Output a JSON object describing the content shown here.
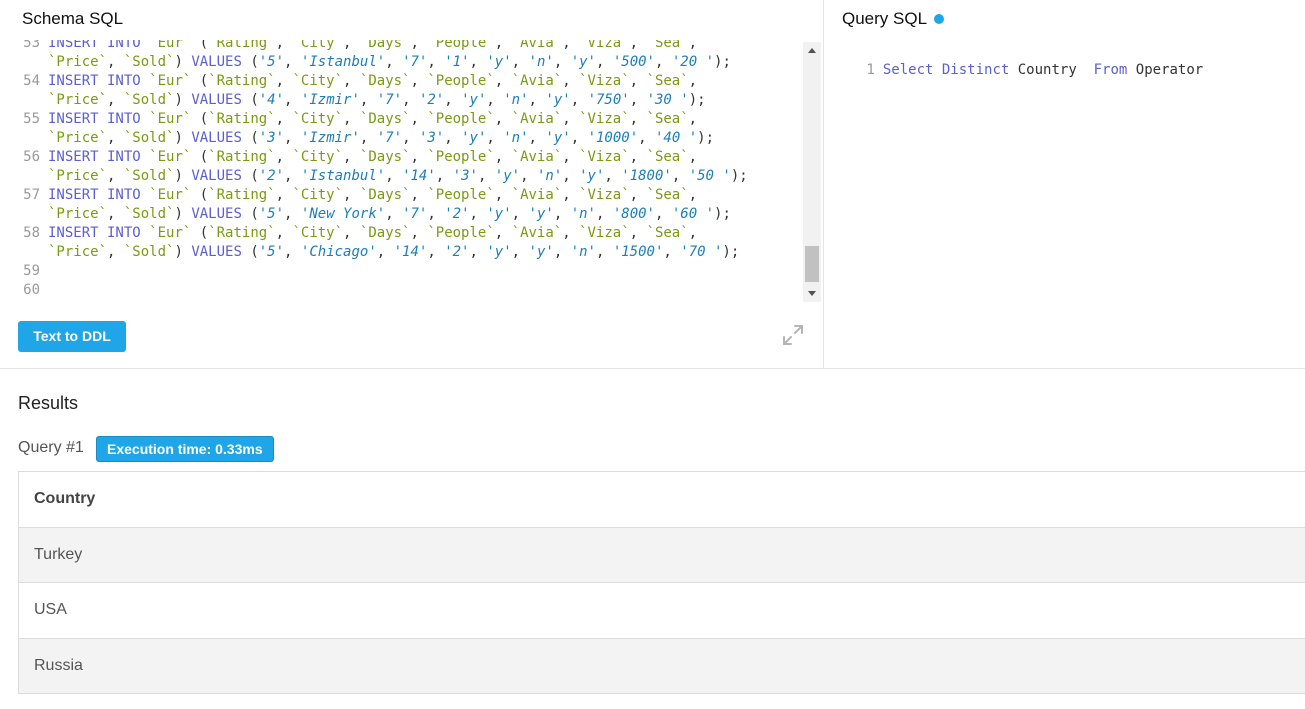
{
  "schema_panel": {
    "title": "Schema SQL",
    "lines": [
      {
        "n": "53",
        "l1": [
          "INSERT INTO `Eur` (`Rating`, `City`, `Days`, `People`, `Avia`, `Viza`, `Sea`,"
        ],
        "l2": "`Price`, `Sold`) VALUES ('5', 'Istanbul', '7', '1', 'y', 'n', 'y', '500', '20 ');"
      },
      {
        "n": "54",
        "l2": "`Price`, `Sold`) VALUES ('4', 'Izmir', '7', '2', 'y', 'n', 'y', '750', '30 ');"
      },
      {
        "n": "55",
        "l2": "`Price`, `Sold`) VALUES ('3', 'Izmir', '7', '3', 'y', 'n', 'y', '1000', '40 ');"
      },
      {
        "n": "56",
        "l2": "`Price`, `Sold`) VALUES ('2', 'Istanbul', '14', '3', 'y', 'n', 'y', '1800', '50 ');"
      },
      {
        "n": "57",
        "l2": "`Price`, `Sold`) VALUES ('5', 'New York', '7', '2', 'y', 'y', 'n', '800', '60 ');"
      },
      {
        "n": "58",
        "l2": "`Price`, `Sold`) VALUES ('5', 'Chicago', '14', '2', 'y', 'y', 'n', '1500', '70 ');"
      },
      {
        "n": "59"
      },
      {
        "n": "60"
      }
    ],
    "ddl_button": "Text to DDL",
    "expand_icon": "expand-arrows-icon"
  },
  "query_panel": {
    "title": "Query SQL",
    "status_dot_color": "#1fa6e8",
    "line_no": "1",
    "kw_select": "Select",
    "kw_distinct": "Distinct",
    "col": "Country",
    "kw_from": "From",
    "table": "Operator"
  },
  "results": {
    "title": "Results",
    "query_label": "Query #1",
    "exec_time": "Execution time: 0.33ms",
    "columns": [
      "Country"
    ],
    "rows": [
      "Turkey",
      "USA",
      "Russia"
    ]
  }
}
